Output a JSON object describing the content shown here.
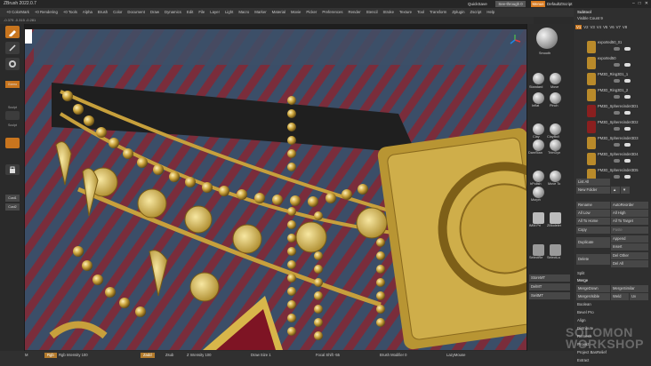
{
  "window": {
    "title": "ZBrush 2022.0.7",
    "quicksave": "QuickSave",
    "seethrough": "See-through 0",
    "menus": "Menus",
    "default_script": "DefaultZScript"
  },
  "menu": [
    "Alpha",
    "Brush",
    "Color",
    "Document",
    "Draw",
    "Dynamics",
    "Edit",
    "File",
    "Layer",
    "Light",
    "Macro",
    "Marker",
    "Material",
    "Movie",
    "Picker",
    "Preferences",
    "Render",
    "Stencil",
    "Stroke",
    "Texture",
    "Tool",
    "Transform",
    "Zplugin",
    "Zscript",
    "Help"
  ],
  "menu_left": [
    "+0 ColorMark",
    "+0 Rendering",
    "+0 Tools"
  ],
  "info": "-0.375 -0.315 -0.281",
  "left_tray": {
    "gizmo": "Gizmo",
    "sculpt1": "Sculpt",
    "sculpt2": "Sculpt",
    "btn1": "Cust1",
    "btn2": "Cust2"
  },
  "brushes": [
    {
      "label": "Smooth"
    },
    {
      "label": "Standard"
    },
    {
      "label": "Move"
    },
    {
      "label": "Inflat"
    },
    {
      "label": "Pinch"
    },
    {
      "label": "Clay"
    },
    {
      "label": "ClayBuil"
    },
    {
      "label": "DamStan"
    },
    {
      "label": "TrimDyn"
    },
    {
      "label": "hPolish"
    },
    {
      "label": "Move To"
    },
    {
      "label": "Morph"
    },
    {
      "label": "IMM Pri"
    },
    {
      "label": "ZModeler"
    },
    {
      "label": "SelectRe"
    },
    {
      "label": "SelectLa"
    }
  ],
  "right_tray_buttons": [
    "StoreMT",
    "DelMT",
    "SwitMT"
  ],
  "subtool": {
    "title": "Subtool",
    "visible_count": "Visible Count 9",
    "version_tabs": [
      "V1",
      "V2",
      "V3",
      "V4",
      "V5",
      "V6",
      "V7",
      "V8"
    ],
    "items": [
      {
        "name": "exported50_01",
        "color": "#b98a2a"
      },
      {
        "name": "exported50",
        "color": "#b98a2a"
      },
      {
        "name": "PM3D_Ring3D1_1",
        "color": "#b98a2a"
      },
      {
        "name": "PM3D_Ring3D1_2",
        "color": "#b98a2a"
      },
      {
        "name": "PM3D_Spherecinder3D1",
        "color": "#8a1f1f"
      },
      {
        "name": "PM3D_Spherecinder3D2",
        "color": "#8a1f1f"
      },
      {
        "name": "PM3D_Spherecinder3D3",
        "color": "#b98a2a"
      },
      {
        "name": "PM3D_Spherecinder3D4",
        "color": "#b98a2a"
      },
      {
        "name": "PM3D_Spherecinder3D5",
        "color": "#b98a2a"
      }
    ],
    "list_all": "List All",
    "new_folder": "New Folder",
    "actions": {
      "rename": "Rename",
      "autoreorder": "AutoReorder",
      "all_low": "All Low",
      "all_high": "All High",
      "all_to_home": "All To Home",
      "all_to_target": "All To Target",
      "copy": "Copy",
      "paste": "Paste",
      "duplicate": "Duplicate",
      "append": "Append",
      "insert": "Insert",
      "delete": "Delete",
      "del_other": "Del Other",
      "del_all": "Del All",
      "split": "Split",
      "merge": "Merge",
      "merge_down": "MergeDown",
      "merge_similar": "MergeSimilar",
      "merge_visible": "MergeVisible",
      "weld": "Weld",
      "uv": "Uv",
      "boolean": "Boolean",
      "bevel_pro": "Bevel Pro",
      "align": "Align",
      "distribute": "Distribute",
      "remesh": "Remesh",
      "project": "Project",
      "project_bas_relief": "Project BasRelief",
      "extract": "Extract"
    }
  },
  "bottom": {
    "m": "M",
    "rgb": "Rgb",
    "rgb_intensity": "Rgb Intensity 100",
    "zadd": "Zadd",
    "zsub": "Zsub",
    "z_intensity": "Z Intensity 100",
    "draw_size": "Draw Size 1",
    "focal_shift": "Focal Shift -55",
    "brush_modifier": "Brush Modifier 0",
    "lazymouse": "LazyMouse"
  },
  "watermark": {
    "line1": "SOLOMON",
    "line2": "WORKSHOP"
  }
}
